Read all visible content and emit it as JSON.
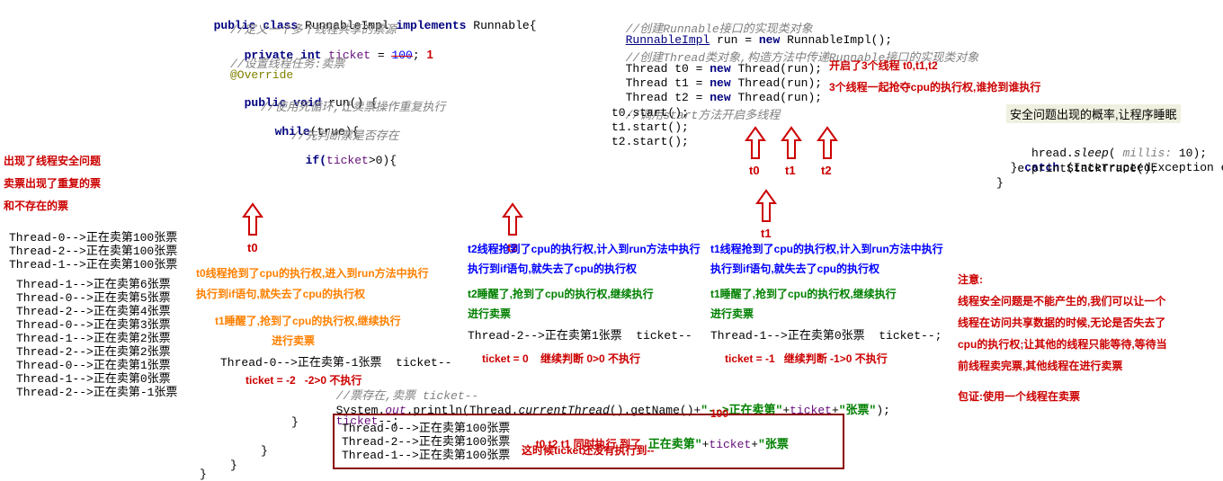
{
  "left_problem": {
    "l1": "出现了线程安全问题",
    "l2": "卖票出现了重复的票",
    "l3": "和不存在的票"
  },
  "output_100": {
    "l1": "Thread-0-->正在卖第100张票",
    "l2": "Thread-2-->正在卖第100张票",
    "l3": "Thread-1-->正在卖第100张票"
  },
  "output_seq": {
    "l1": "Thread-1-->正在卖第6张票",
    "l2": "Thread-0-->正在卖第5张票",
    "l3": "Thread-2-->正在卖第4张票",
    "l4": "Thread-0-->正在卖第3张票",
    "l5": "Thread-1-->正在卖第2张票",
    "l6": "Thread-2-->正在卖第2张票",
    "l7": "Thread-0-->正在卖第1张票",
    "l8": "Thread-1-->正在卖第0张票",
    "l9": "Thread-2-->正在卖第-1张票"
  },
  "code_left": {
    "l1_pub": "public class ",
    "l1_cls": "RunnableImpl ",
    "l1_impl": "implements ",
    "l1_run": "Runnable{",
    "c1": "//定义一个多个线程共享的票源",
    "l2_priv": "private int ",
    "l2_fld": "ticket ",
    "l2_eq": "= ",
    "l2_old": "100",
    "l2_semi": "; ",
    "l2_new": "1",
    "c2": "//设置线程任务:卖票",
    "over": "@Override",
    "l3": "public void ",
    "l3_run": "run() {",
    "c3": "//使用死循环,让卖票操作重复执行",
    "l4": "while",
    "l4b": "(true){",
    "c4": "//先判断票是否存在",
    "l5": "if(",
    "l5_fld": "ticket",
    "l5_gt": ">0){"
  },
  "code_right": {
    "c1": "//创建",
    "c1b": "Runnable",
    "c1c": "接口的实现类对象",
    "l1a": "RunnableImpl",
    "l1b": " run = ",
    "l1c": "new ",
    "l1d": "RunnableImpl();",
    "c2a": "//创建",
    "c2b": "Thread",
    "c2c": "类对象,构造方法中传递",
    "c2d": "Runnable",
    "c2e": "接口的实现类对象",
    "l2": "Thread t0 = ",
    "l2n": "new ",
    "l2t": "Thread(run);",
    "l3": "Thread t1 = ",
    "l4": "Thread t2 = ",
    "c3": "//调用",
    "c3b": "start",
    "c3c": "方法开启多线程",
    "l5": "t0.start();",
    "l6": "t1.start();",
    "l7": "t2.start();"
  },
  "red_right_1": "开启了3个线程 t0,t1,t2",
  "red_right_2": "3个线程一起抢夺cpu的执行权,谁抢到谁执行",
  "far_right": {
    "l1": "安全问题出现的概率,让程序睡眠",
    "l2a": "   hread.",
    "l2b": "sleep",
    "l2c": "( ",
    "l2d": "millis: ",
    "l2e": "10);",
    "l3a": "} ",
    "l3b": "catch ",
    "l3c": "(InterruptedException e) {",
    "l4": "   e.printStackTrace();",
    "l5": "}"
  },
  "arrow_labels": {
    "t0_left": "t0",
    "t2_mid": "t2",
    "t0_r": "t0",
    "t1_r": "t1",
    "t2_r": "t2",
    "t1_below": "t1"
  },
  "t0_orange": {
    "l1": "t0线程抢到了cpu的执行权,进入到run方法中执行",
    "l2": "执行到if语句,就失去了cpu的执行权",
    "l3": "t1睡醒了,抢到了cpu的执行权,继续执行",
    "l4": "进行卖票"
  },
  "t2_col": {
    "b1": "t2线程抢到了cpu的执行权,计入到run方法中执行",
    "b2": "执行到if语句,就失去了cpu的执行权",
    "g1": "t2睡醒了,抢到了cpu的执行权,继续执行",
    "g2": "进行卖票",
    "out": "Thread-2-->正在卖第1张票  ticket--",
    "r": "ticket = 0    继续判断 0>0 不执行"
  },
  "t1_col": {
    "b1": "t1线程抢到了cpu的执行权,计入到run方法中执行",
    "b2": "执行到if语句,就失去了cpu的执行权",
    "g1": "t1睡醒了,抢到了cpu的执行权,继续执行",
    "g2": "进行卖票",
    "out": "Thread-1-->正在卖第0张票  ticket--;",
    "r": "ticket = -1   继续判断 -1>0 不执行"
  },
  "t0_col_out": "Thread-0-->正在卖第-1张票  ticket--",
  "t0_col_red": "ticket = -2   -2>0 不执行",
  "code_bottom": {
    "c1": "//票存在,卖票 ",
    "c1b": "ticket--",
    "l1a": "System.",
    "l1b": "out",
    "l1c": ".println(Thread.",
    "l1d": "currentThread",
    "l1e": "().getName()+",
    "l1s1": "\"-->正在卖第\"",
    "l1p": "+",
    "l1f": "ticket",
    "l1p2": "+",
    "l1s2": "\"张票\"",
    "l1end": ");",
    "l2a": "ticket",
    "l2b": "--;"
  },
  "box_out": {
    "l1": "Thread-0-->正在卖第100张票",
    "l2": "Thread-2-->正在卖第100张票",
    "l3": "Thread-1-->正在卖第100张票"
  },
  "box_red1": "t0 t2 t1 同时执行 到了",
  "box_green1": "正在卖第\"",
  "box_plus": "+",
  "box_ticket": "ticket",
  "box_plus2": "+",
  "box_green2": "\"张票",
  "box_100": "100",
  "box_red2": "这时候ticket还没有执行到--",
  "notes": {
    "t": "注意:",
    "l1": "线程安全问题是不能产生的,我们可以让一个",
    "l2": "线程在访问共享数据的时候,无论是否失去了",
    "l3": "cpu的执行权;让其他的线程只能等待,等待当",
    "l4": "前线程卖完票,其他线程在进行卖票",
    "l5": "包证:使用一个线程在卖票"
  },
  "brace1": "}",
  "brace2": "}",
  "brace3": "}",
  "brace4": "}"
}
